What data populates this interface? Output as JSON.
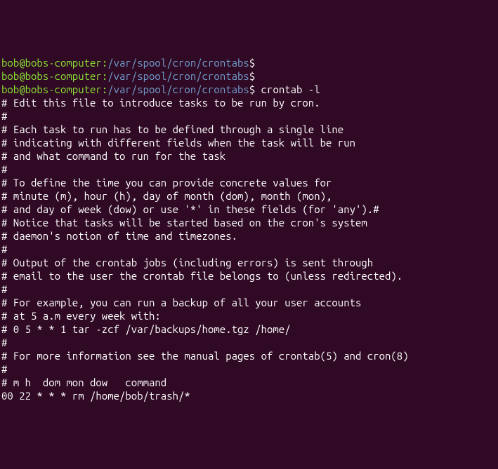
{
  "prompts": [
    {
      "user_host": "bob@bobs-computer",
      "path": "/var/spool/cron/crontabs",
      "command": ""
    },
    {
      "user_host": "bob@bobs-computer",
      "path": "/var/spool/cron/crontabs",
      "command": ""
    },
    {
      "user_host": "bob@bobs-computer",
      "path": "/var/spool/cron/crontabs",
      "command": "crontab -l"
    }
  ],
  "output_lines": [
    "# Edit this file to introduce tasks to be run by cron.",
    "#",
    "# Each task to run has to be defined through a single line",
    "# indicating with different fields when the task will be run",
    "# and what command to run for the task",
    "#",
    "# To define the time you can provide concrete values for",
    "# minute (m), hour (h), day of month (dom), month (mon),",
    "# and day of week (dow) or use '*' in these fields (for 'any').#",
    "# Notice that tasks will be started based on the cron's system",
    "# daemon's notion of time and timezones.",
    "#",
    "# Output of the crontab jobs (including errors) is sent through",
    "# email to the user the crontab file belongs to (unless redirected).",
    "#",
    "# For example, you can run a backup of all your user accounts",
    "# at 5 a.m every week with:",
    "# 0 5 * * 1 tar -zcf /var/backups/home.tgz /home/",
    "#",
    "# For more information see the manual pages of crontab(5) and cron(8)",
    "#",
    "# m h  dom mon dow   command",
    "",
    "00 22 * * * rm /home/bob/trash/*"
  ]
}
